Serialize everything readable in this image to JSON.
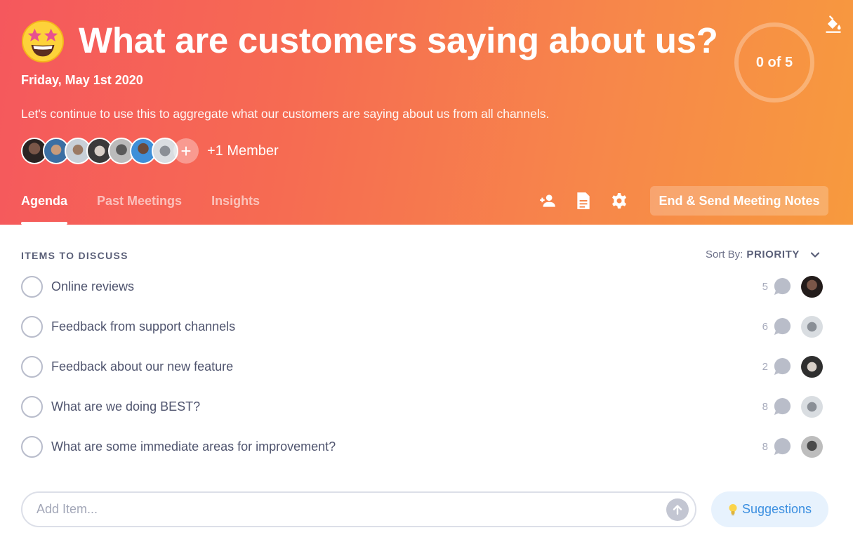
{
  "header": {
    "title": "What are customers saying about us?",
    "date": "Friday, May 1st 2020",
    "description": "Let's continue to use this to aggregate what our customers are saying about us from all channels.",
    "progress": "0 of 5",
    "emoji": "star-struck-emoji",
    "members": {
      "avatars": [
        "avatar-1",
        "avatar-2",
        "avatar-3",
        "avatar-4",
        "avatar-5",
        "avatar-6",
        "avatar-7"
      ],
      "add_label": "+",
      "extra_label": "+1 Member"
    }
  },
  "tabs": [
    {
      "label": "Agenda",
      "active": true
    },
    {
      "label": "Past Meetings",
      "active": false
    },
    {
      "label": "Insights",
      "active": false
    }
  ],
  "actions": {
    "icons": [
      "add-person-icon",
      "document-icon",
      "gear-icon"
    ],
    "end_button": "End & Send Meeting Notes"
  },
  "agenda": {
    "section_title": "ITEMS TO DISCUSS",
    "sort_label": "Sort By:",
    "sort_value": "PRIORITY",
    "items": [
      {
        "label": "Online reviews",
        "comments": "5"
      },
      {
        "label": "Feedback from support channels",
        "comments": "6"
      },
      {
        "label": "Feedback about our new feature",
        "comments": "2"
      },
      {
        "label": "What are we doing BEST?",
        "comments": "8"
      },
      {
        "label": "What are some immediate areas for improvement?",
        "comments": "8"
      }
    ]
  },
  "add_item": {
    "placeholder": "Add Item...",
    "suggestions_label": "Suggestions"
  },
  "colors": {
    "gradient_start": "#f5585d",
    "gradient_end": "#f79a3e",
    "accent_blue": "#3b8fe0"
  }
}
